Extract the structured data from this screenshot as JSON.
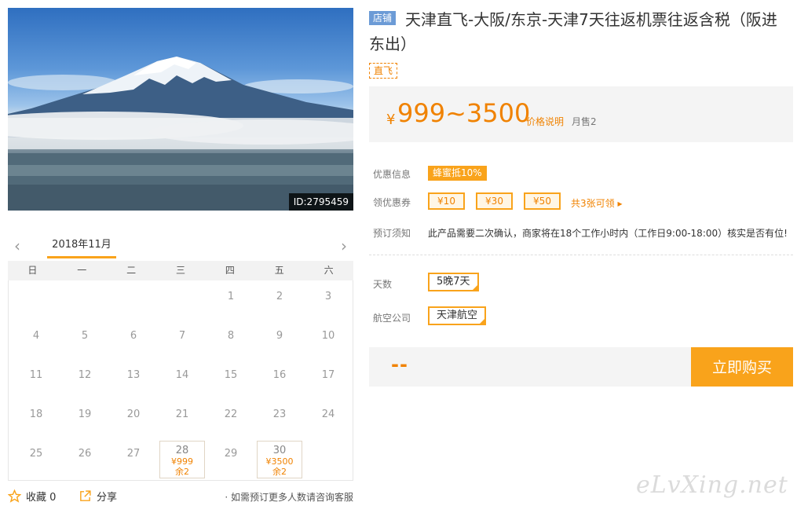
{
  "hero": {
    "image_id": "ID:2795459"
  },
  "calendar": {
    "month": "2018年11月",
    "weekdays": [
      "日",
      "一",
      "二",
      "三",
      "四",
      "五",
      "六"
    ],
    "rows": [
      [
        {
          "day": ""
        },
        {
          "day": ""
        },
        {
          "day": ""
        },
        {
          "day": ""
        },
        {
          "day": "1"
        },
        {
          "day": "2"
        },
        {
          "day": "3"
        }
      ],
      [
        {
          "day": "4"
        },
        {
          "day": "5"
        },
        {
          "day": "6"
        },
        {
          "day": "7"
        },
        {
          "day": "8"
        },
        {
          "day": "9"
        },
        {
          "day": "10"
        }
      ],
      [
        {
          "day": "11"
        },
        {
          "day": "12"
        },
        {
          "day": "13"
        },
        {
          "day": "14"
        },
        {
          "day": "15"
        },
        {
          "day": "16"
        },
        {
          "day": "17"
        }
      ],
      [
        {
          "day": "18"
        },
        {
          "day": "19"
        },
        {
          "day": "20"
        },
        {
          "day": "21"
        },
        {
          "day": "22"
        },
        {
          "day": "23"
        },
        {
          "day": "24"
        }
      ],
      [
        {
          "day": "25"
        },
        {
          "day": "26"
        },
        {
          "day": "27"
        },
        {
          "day": "28",
          "price": "¥999",
          "stock": "余2"
        },
        {
          "day": "29"
        },
        {
          "day": "30",
          "price": "¥3500",
          "stock": "余2"
        },
        {
          "day": ""
        }
      ]
    ]
  },
  "footer": {
    "favorite_label": "收藏",
    "favorite_count": "0",
    "share_label": "分享",
    "note": "· 如需预订更多人数请咨询客服"
  },
  "product": {
    "store_badge": "店铺",
    "title": "天津直飞-大阪/东京-天津7天往返机票往返含税（阪进东出）",
    "tag": "直飞"
  },
  "price": {
    "currency": "¥",
    "range": "999~3500",
    "explain_link": "价格说明",
    "monthly_sales": "月售2"
  },
  "promo": {
    "label": "优惠信息",
    "badge": "蜂蜜抵10%"
  },
  "coupons": {
    "label": "领优惠券",
    "items": [
      "¥10",
      "¥30",
      "¥50"
    ],
    "more": "共3张可领 ▸"
  },
  "booking": {
    "label": "预订须知",
    "text": "此产品需要二次确认，商家将在18个工作小时内（工作日9:00-18:00）核实是否有位!"
  },
  "options": {
    "days_label": "天数",
    "days_value": "5晚7天",
    "airline_label": "航空公司",
    "airline_value": "天津航空"
  },
  "buy": {
    "total": "--",
    "button": "立即购买"
  },
  "watermark": "eLvXing.net",
  "colors": {
    "accent": "#f9a31b",
    "price": "#f08200",
    "store_badge": "#6c9bd6"
  }
}
